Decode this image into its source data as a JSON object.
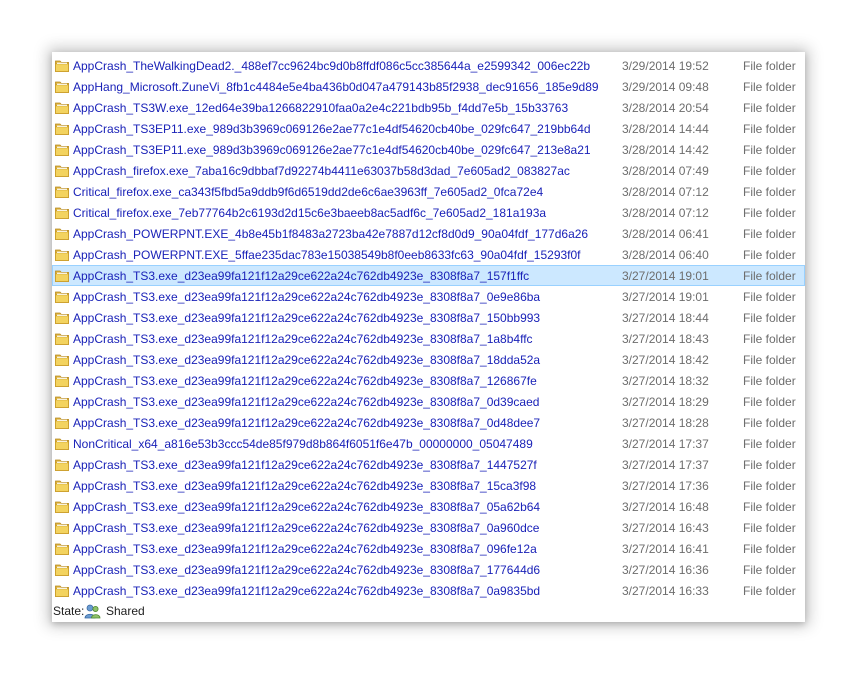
{
  "icons": {
    "folder": "folder-icon",
    "shared": "shared-users-icon"
  },
  "colors": {
    "link_text": "#1a22b8",
    "meta_text": "#6d6d6d",
    "selection_bg": "#cce8ff",
    "selection_border": "#99d1ff"
  },
  "files": [
    {
      "name": "AppCrash_TheWalkingDead2._488ef7cc9624bc9d0b8ffdf086c5cc385644a_e2599342_006ec22b",
      "date": "3/29/2014 19:52",
      "type": "File folder"
    },
    {
      "name": "AppHang_Microsoft.ZuneVi_8fb1c4484e5e4ba436b0d047a479143b85f2938_dec91656_185e9d89",
      "date": "3/29/2014 09:48",
      "type": "File folder"
    },
    {
      "name": "AppCrash_TS3W.exe_12ed64e39ba1266822910faa0a2e4c221bdb95b_f4dd7e5b_15b33763",
      "date": "3/28/2014 20:54",
      "type": "File folder"
    },
    {
      "name": "AppCrash_TS3EP11.exe_989d3b3969c069126e2ae77c1e4df54620cb40be_029fc647_219bb64d",
      "date": "3/28/2014 14:44",
      "type": "File folder"
    },
    {
      "name": "AppCrash_TS3EP11.exe_989d3b3969c069126e2ae77c1e4df54620cb40be_029fc647_213e8a21",
      "date": "3/28/2014 14:42",
      "type": "File folder"
    },
    {
      "name": "AppCrash_firefox.exe_7aba16c9dbbaf7d92274b4411e63037b58d3dad_7e605ad2_083827ac",
      "date": "3/28/2014 07:49",
      "type": "File folder"
    },
    {
      "name": "Critical_firefox.exe_ca343f5fbd5a9ddb9f6d6519dd2de6c6ae3963ff_7e605ad2_0fca72e4",
      "date": "3/28/2014 07:12",
      "type": "File folder"
    },
    {
      "name": "Critical_firefox.exe_7eb77764b2c6193d2d15c6e3baeeb8ac5adf6c_7e605ad2_181a193a",
      "date": "3/28/2014 07:12",
      "type": "File folder"
    },
    {
      "name": "AppCrash_POWERPNT.EXE_4b8e45b1f8483a2723ba42e7887d12cf8d0d9_90a04fdf_177d6a26",
      "date": "3/28/2014 06:41",
      "type": "File folder"
    },
    {
      "name": "AppCrash_POWERPNT.EXE_5ffae235dac783e15038549b8f0eeb8633fc63_90a04fdf_15293f0f",
      "date": "3/28/2014 06:40",
      "type": "File folder"
    },
    {
      "name": "AppCrash_TS3.exe_d23ea99fa121f12a29ce622a24c762db4923e_8308f8a7_157f1ffc",
      "date": "3/27/2014 19:01",
      "type": "File folder",
      "selected": true
    },
    {
      "name": "AppCrash_TS3.exe_d23ea99fa121f12a29ce622a24c762db4923e_8308f8a7_0e9e86ba",
      "date": "3/27/2014 19:01",
      "type": "File folder"
    },
    {
      "name": "AppCrash_TS3.exe_d23ea99fa121f12a29ce622a24c762db4923e_8308f8a7_150bb993",
      "date": "3/27/2014 18:44",
      "type": "File folder"
    },
    {
      "name": "AppCrash_TS3.exe_d23ea99fa121f12a29ce622a24c762db4923e_8308f8a7_1a8b4ffc",
      "date": "3/27/2014 18:43",
      "type": "File folder"
    },
    {
      "name": "AppCrash_TS3.exe_d23ea99fa121f12a29ce622a24c762db4923e_8308f8a7_18dda52a",
      "date": "3/27/2014 18:42",
      "type": "File folder"
    },
    {
      "name": "AppCrash_TS3.exe_d23ea99fa121f12a29ce622a24c762db4923e_8308f8a7_126867fe",
      "date": "3/27/2014 18:32",
      "type": "File folder"
    },
    {
      "name": "AppCrash_TS3.exe_d23ea99fa121f12a29ce622a24c762db4923e_8308f8a7_0d39caed",
      "date": "3/27/2014 18:29",
      "type": "File folder"
    },
    {
      "name": "AppCrash_TS3.exe_d23ea99fa121f12a29ce622a24c762db4923e_8308f8a7_0d48dee7",
      "date": "3/27/2014 18:28",
      "type": "File folder"
    },
    {
      "name": "NonCritical_x64_a816e53b3ccc54de85f979d8b864f6051f6e47b_00000000_05047489",
      "date": "3/27/2014 17:37",
      "type": "File folder"
    },
    {
      "name": "AppCrash_TS3.exe_d23ea99fa121f12a29ce622a24c762db4923e_8308f8a7_1447527f",
      "date": "3/27/2014 17:37",
      "type": "File folder"
    },
    {
      "name": "AppCrash_TS3.exe_d23ea99fa121f12a29ce622a24c762db4923e_8308f8a7_15ca3f98",
      "date": "3/27/2014 17:36",
      "type": "File folder"
    },
    {
      "name": "AppCrash_TS3.exe_d23ea99fa121f12a29ce622a24c762db4923e_8308f8a7_05a62b64",
      "date": "3/27/2014 16:48",
      "type": "File folder"
    },
    {
      "name": "AppCrash_TS3.exe_d23ea99fa121f12a29ce622a24c762db4923e_8308f8a7_0a960dce",
      "date": "3/27/2014 16:43",
      "type": "File folder"
    },
    {
      "name": "AppCrash_TS3.exe_d23ea99fa121f12a29ce622a24c762db4923e_8308f8a7_096fe12a",
      "date": "3/27/2014 16:41",
      "type": "File folder"
    },
    {
      "name": "AppCrash_TS3.exe_d23ea99fa121f12a29ce622a24c762db4923e_8308f8a7_177644d6",
      "date": "3/27/2014 16:36",
      "type": "File folder"
    },
    {
      "name": "AppCrash_TS3.exe_d23ea99fa121f12a29ce622a24c762db4923e_8308f8a7_0a9835bd",
      "date": "3/27/2014 16:33",
      "type": "File folder"
    }
  ],
  "status_bar": {
    "label": "State:",
    "value": "Shared"
  }
}
